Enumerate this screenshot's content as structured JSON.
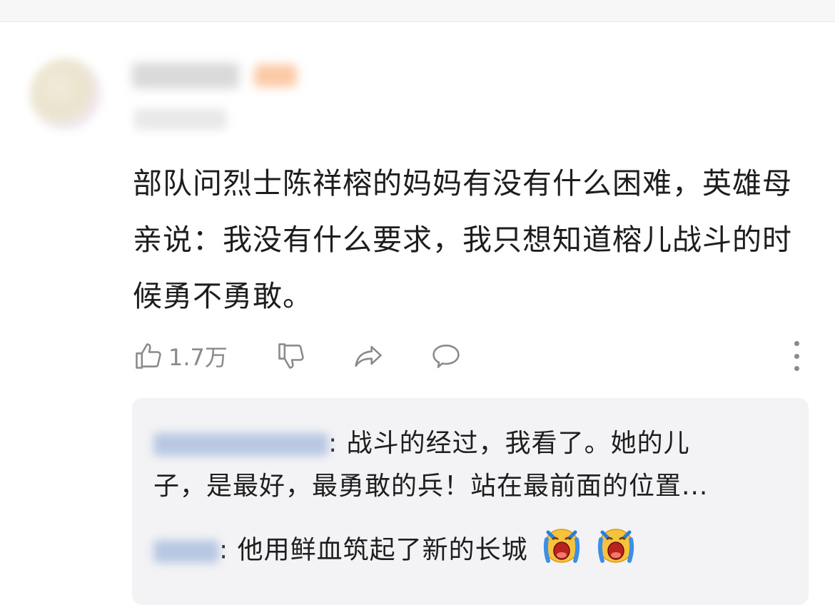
{
  "comment": {
    "text": "部队问烈士陈祥榕的妈妈有没有什么困难，英雄母亲说：我没有什么要求，我只想知道榕儿战斗的时候勇不勇敢。",
    "actions": {
      "like_icon": "thumbs-up-icon",
      "like_count": "1.7万",
      "dislike_icon": "thumbs-down-icon",
      "share_icon": "share-icon",
      "reply_icon": "comment-bubble-icon",
      "more_icon": "more-vertical-icon"
    }
  },
  "replies": [
    {
      "text": ": 战斗的经过，我看了。她的儿",
      "text_cont": "子，是最好，最勇敢的兵！站在最前面的位置..."
    },
    {
      "text": ": 他用鲜血筑起了新的长城",
      "emojis": [
        "crying-face-icon",
        "crying-face-icon"
      ]
    }
  ],
  "colors": {
    "text_primary": "#1d1d1d",
    "text_secondary": "#8a8a8a",
    "reply_background": "#f3f3f5"
  }
}
